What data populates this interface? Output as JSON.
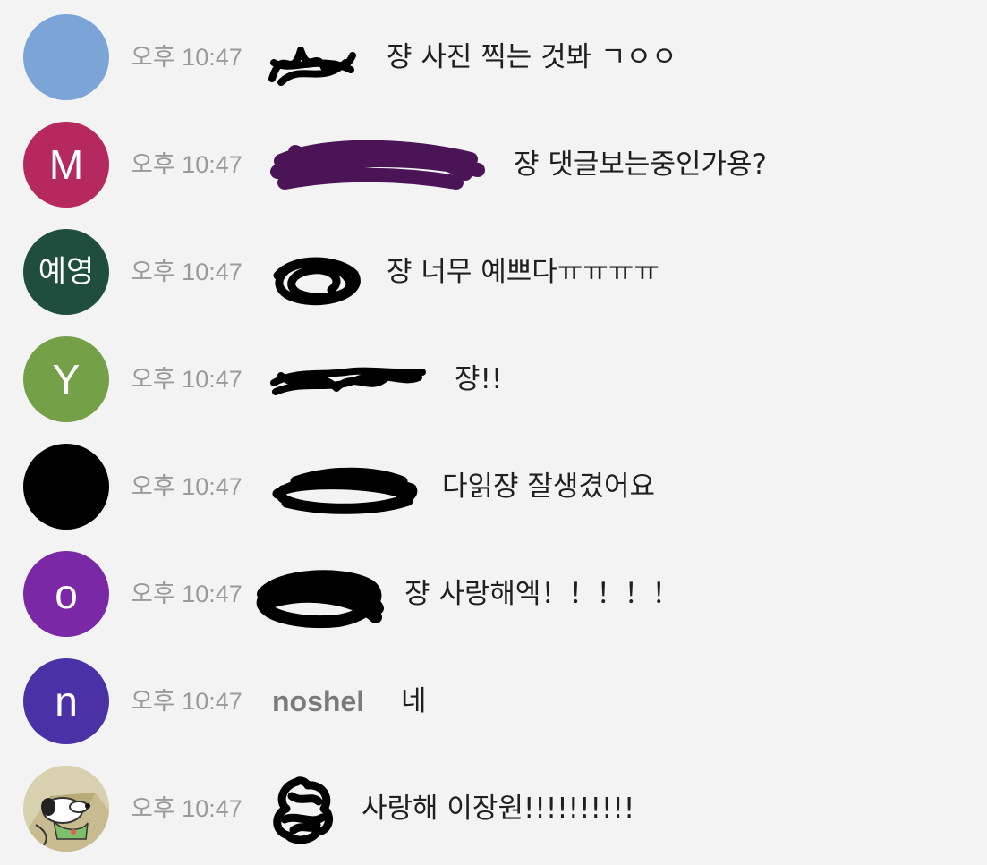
{
  "colors": {
    "background": "#f3f3f3",
    "timestamp": "#9a9a9a",
    "author": "#7a7a7a",
    "message": "#1f1f1f",
    "redaction_black": "#000000",
    "redaction_purple": "#4b1456"
  },
  "messages": [
    {
      "avatar": {
        "initial": "",
        "color": "#7ba5d6"
      },
      "time": "오후 10:47",
      "author": "",
      "author_redacted": true,
      "text": "쟝 사진 찍는 것봐 ㄱㅇㅇ"
    },
    {
      "avatar": {
        "initial": "M",
        "color": "#b5295f"
      },
      "time": "오후 10:47",
      "author": "",
      "author_redacted": true,
      "text": "쟝 댓글보는중인가용?"
    },
    {
      "avatar": {
        "initial": "예영",
        "color": "#1f4e3f"
      },
      "time": "오후 10:47",
      "author": "",
      "author_redacted": true,
      "text": "쟝 너무 예쁘다ㅠㅠㅠㅠ"
    },
    {
      "avatar": {
        "initial": "Y",
        "color": "#74a048"
      },
      "time": "오후 10:47",
      "author": "",
      "author_redacted": true,
      "text": "쟝!!"
    },
    {
      "avatar": {
        "initial": "",
        "color": "#000000"
      },
      "time": "오후 10:47",
      "author": "",
      "author_redacted": true,
      "text": "다읽쟝 잘생겼어요"
    },
    {
      "avatar": {
        "initial": "o",
        "color": "#7a28a5"
      },
      "time": "오후 10:47",
      "author": "",
      "author_redacted": true,
      "text": "쟝 사랑해엑！！！！！"
    },
    {
      "avatar": {
        "initial": "n",
        "color": "#4a32a6"
      },
      "time": "오후 10:47",
      "author": "noshel",
      "author_redacted": false,
      "text": "네"
    },
    {
      "avatar": {
        "initial": "",
        "color": "#d9d3b4",
        "image": "snoopy-avatar-image"
      },
      "time": "오후 10:47",
      "author": "",
      "author_redacted": true,
      "text": "사랑해 이장원!!!!!!!!!!"
    }
  ]
}
